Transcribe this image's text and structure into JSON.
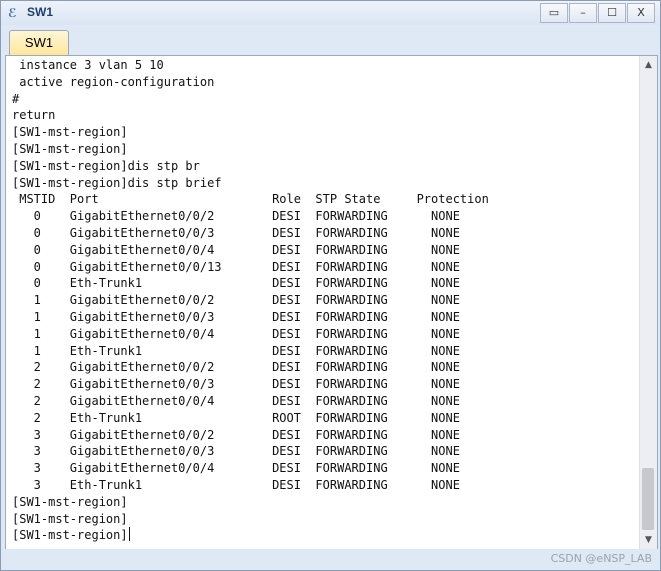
{
  "window": {
    "title": "SW1",
    "icon": "app-icon",
    "controls": {
      "restore_label": "▭",
      "minimize_label": "–",
      "maximize_label": "☐",
      "close_label": "X"
    }
  },
  "tabs": [
    {
      "label": "SW1",
      "active": true
    }
  ],
  "terminal": {
    "lines": [
      " instance 3 vlan 5 10",
      " active region-configuration",
      "#",
      "return",
      "[SW1-mst-region]",
      "[SW1-mst-region]",
      "[SW1-mst-region]dis stp br",
      "[SW1-mst-region]dis stp brief",
      " MSTID  Port                        Role  STP State     Protection",
      "   0    GigabitEthernet0/0/2        DESI  FORWARDING      NONE",
      "   0    GigabitEthernet0/0/3        DESI  FORWARDING      NONE",
      "   0    GigabitEthernet0/0/4        DESI  FORWARDING      NONE",
      "   0    GigabitEthernet0/0/13       DESI  FORWARDING      NONE",
      "   0    Eth-Trunk1                  DESI  FORWARDING      NONE",
      "   1    GigabitEthernet0/0/2        DESI  FORWARDING      NONE",
      "   1    GigabitEthernet0/0/3        DESI  FORWARDING      NONE",
      "   1    GigabitEthernet0/0/4        DESI  FORWARDING      NONE",
      "   1    Eth-Trunk1                  DESI  FORWARDING      NONE",
      "   2    GigabitEthernet0/0/2        DESI  FORWARDING      NONE",
      "   2    GigabitEthernet0/0/3        DESI  FORWARDING      NONE",
      "   2    GigabitEthernet0/0/4        DESI  FORWARDING      NONE",
      "   2    Eth-Trunk1                  ROOT  FORWARDING      NONE",
      "   3    GigabitEthernet0/0/2        DESI  FORWARDING      NONE",
      "   3    GigabitEthernet0/0/3        DESI  FORWARDING      NONE",
      "   3    GigabitEthernet0/0/4        DESI  FORWARDING      NONE",
      "   3    Eth-Trunk1                  DESI  FORWARDING      NONE",
      "[SW1-mst-region]",
      "[SW1-mst-region]",
      "[SW1-mst-region]"
    ],
    "scroll_position": 0.9
  },
  "scrollbar": {
    "up_arrow": "▲",
    "down_arrow": "▼"
  },
  "watermark": "CSDN @eNSP_LAB",
  "colors": {
    "chrome_bg": "#dfe8f5",
    "tab_active": "#ffe79a",
    "terminal_bg": "#ffffff",
    "text": "#111111"
  }
}
